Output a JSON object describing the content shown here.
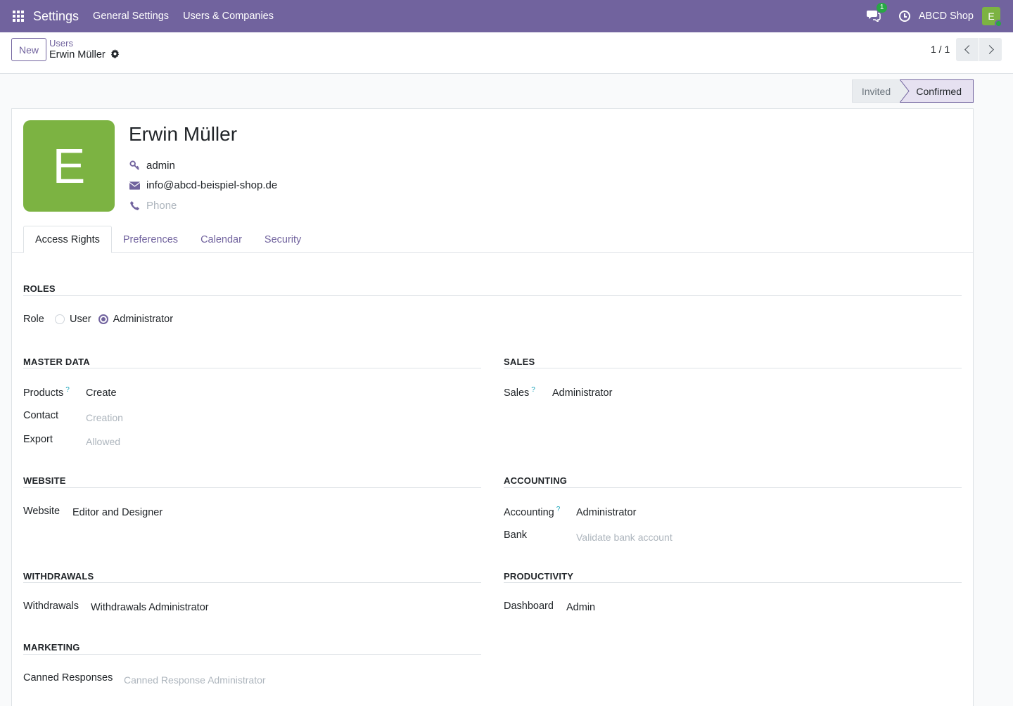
{
  "navbar": {
    "app_name": "Settings",
    "menu": [
      "General Settings",
      "Users & Companies"
    ],
    "chat_badge": "1",
    "company": "ABCD Shop",
    "user_initial": "E",
    "accent": "#71639e"
  },
  "control_panel": {
    "new_label": "New",
    "breadcrumb_parent": "Users",
    "breadcrumb_current": "Erwin Müller",
    "pager": "1 / 1"
  },
  "statusbar": {
    "stages": [
      "Invited",
      "Confirmed"
    ],
    "current": "Confirmed"
  },
  "user": {
    "initial": "E",
    "avatar_color": "#7cb342",
    "name": "Erwin Müller",
    "login": "admin",
    "email": "info@abcd-beispiel-shop.de",
    "phone_placeholder": "Phone"
  },
  "tabs": [
    "Access Rights",
    "Preferences",
    "Calendar",
    "Security"
  ],
  "active_tab": "Access Rights",
  "roles": {
    "title": "ROLES",
    "label": "Role",
    "options": [
      "User",
      "Administrator"
    ],
    "selected": "Administrator"
  },
  "master_data": {
    "title": "MASTER DATA",
    "fields": [
      {
        "label": "Products",
        "help": "?",
        "value": "Create",
        "placeholder": false
      },
      {
        "label": "Contact",
        "value": "Creation",
        "placeholder": true
      },
      {
        "label": "Export",
        "value": "Allowed",
        "placeholder": true
      }
    ]
  },
  "sales": {
    "title": "SALES",
    "fields": [
      {
        "label": "Sales",
        "help": "?",
        "value": "Administrator",
        "placeholder": false
      }
    ]
  },
  "website": {
    "title": "WEBSITE",
    "fields": [
      {
        "label": "Website",
        "value": "Editor and Designer",
        "placeholder": false
      }
    ]
  },
  "accounting": {
    "title": "ACCOUNTING",
    "fields": [
      {
        "label": "Accounting",
        "help": "?",
        "value": "Administrator",
        "placeholder": false
      },
      {
        "label": "Bank",
        "value": "Validate bank account",
        "placeholder": true
      }
    ]
  },
  "withdrawals": {
    "title": "WITHDRAWALS",
    "fields": [
      {
        "label": "Withdrawals",
        "value": "Withdrawals Administrator",
        "placeholder": false
      }
    ]
  },
  "productivity": {
    "title": "PRODUCTIVITY",
    "fields": [
      {
        "label": "Dashboard",
        "value": "Admin",
        "placeholder": false
      }
    ]
  },
  "marketing": {
    "title": "MARKETING",
    "fields": [
      {
        "label": "Canned Responses",
        "value": "Canned Response Administrator",
        "placeholder": true
      }
    ]
  }
}
